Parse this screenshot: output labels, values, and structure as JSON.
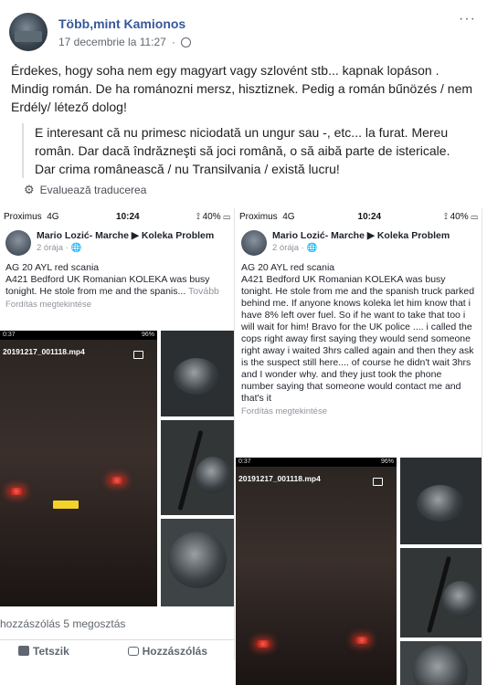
{
  "post": {
    "author": "Több,mint Kamionos",
    "date": "17 decembrie la 11:27",
    "separator": "·",
    "more": "···",
    "text": "Érdekes, hogy soha nem egy magyart vagy szlovént stb... kapnak lopáson . Mindig román. De ha románozni mersz, hisztiznek. Pedig a román bűnözés / nem Erdély/ létező dolog!",
    "translation": "E interesant că nu primesc niciodată un ungur sau -, etc... la furat. Mereu român. Dar dacă îndrăzneşti să joci română, o să aibă parte de istericale. Dar crima românească / nu Transilvania / există lucru!",
    "rate_translation": "Evaluează traducerea"
  },
  "screenshot_left": {
    "carrier": "Proximus",
    "network": "4G",
    "time": "10:24",
    "battery": "40%",
    "author": "Mario Lozić- Marche ▶ Koleka Problem",
    "time_ago": "2 órája · 🌐",
    "line1": "AG 20 AYL red scania",
    "line2": "A421 Bedford UK Romanian KOLEKA was busy tonight. He stole from me and the spanis...",
    "more": "Tovább",
    "translate": "Fordítás megtekintése",
    "video_status": "0:37",
    "video_battery": "96%",
    "video_title": "20191217_001118.mp4"
  },
  "screenshot_right": {
    "carrier": "Proximus",
    "network": "4G",
    "time": "10:24",
    "battery": "40%",
    "author": "Mario Lozić- Marche ▶ Koleka Problem",
    "time_ago": "2 órája · 🌐",
    "line1": "AG 20 AYL red scania",
    "body": "A421 Bedford UK Romanian KOLEKA was busy tonight. He stole from me and the spanish truck parked behind me. If anyone knows koleka let him know that i have 8% left over fuel. So if he want to take that too i will wait for him! Bravo for the UK police .... i called the cops right away first saying they would send someone right away i waited 3hrs called again and then they ask is the suspect still here.... of course he didn't wait 3hrs and I wonder why. and they just took the phone number saying that someone would contact me and that's it",
    "translate": "Fordítás megtekintése",
    "video_status": "0:37",
    "video_battery": "96%",
    "video_title": "20191217_001118.mp4"
  },
  "footer": {
    "stats": "hozzászólás  5 megosztás",
    "like": "Tetszik",
    "comment": "Hozzászólás"
  },
  "colors": {
    "link": "#365899",
    "meta": "#616770"
  }
}
